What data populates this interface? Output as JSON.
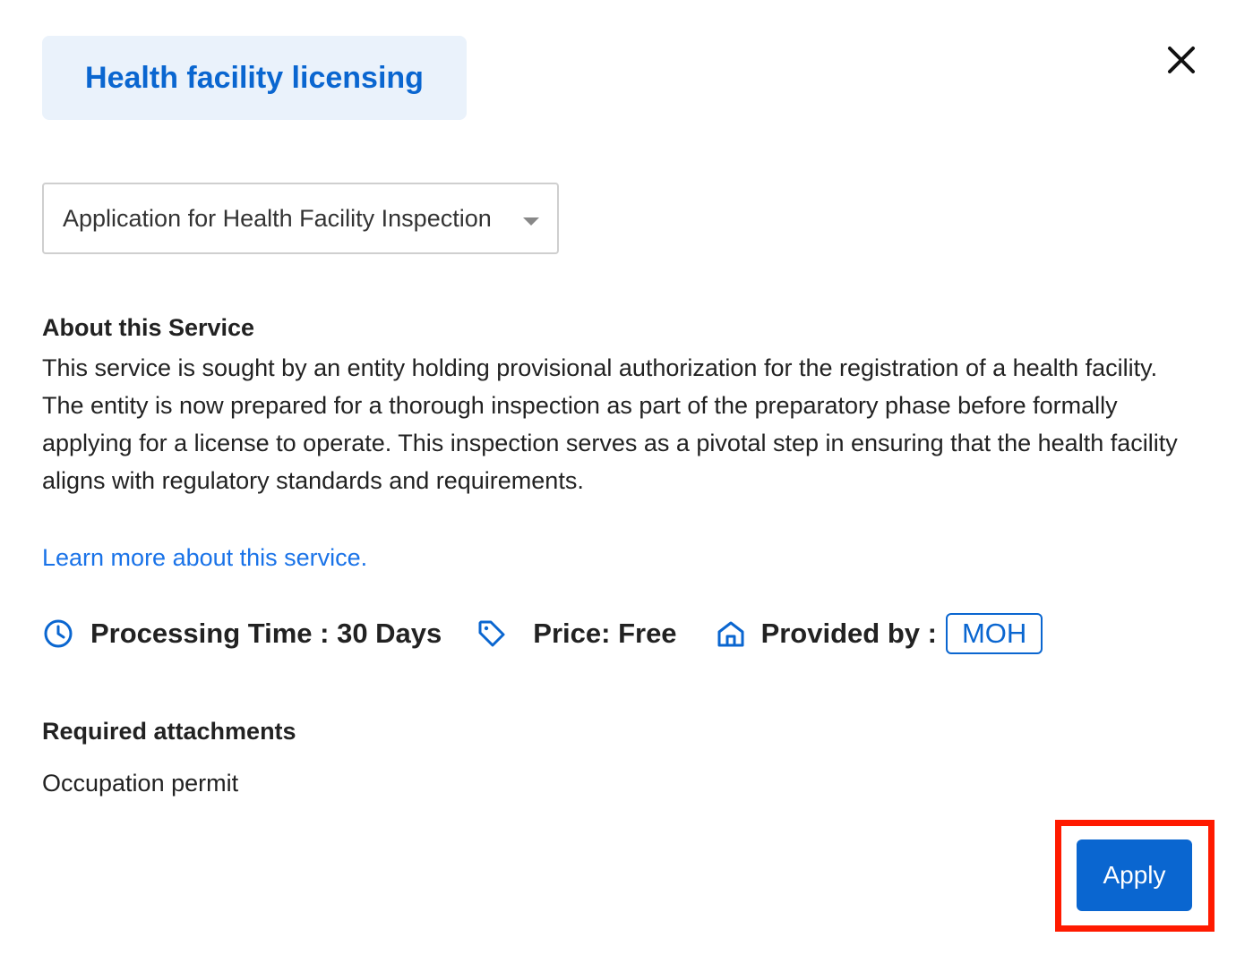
{
  "header": {
    "category_chip": "Health facility licensing",
    "close_icon": "close-icon"
  },
  "service_select": {
    "selected": "Application for Health Facility Inspection",
    "icon": "chevron-down-icon"
  },
  "about": {
    "heading": "About this Service",
    "body": "This service is sought by an entity holding provisional authorization for the registration of a health facility. The entity is now prepared for a thorough inspection as part of the preparatory phase before formally applying for a license to operate. This inspection serves as a pivotal step in ensuring that the health facility aligns with regulatory standards and requirements."
  },
  "learn_more": "Learn more about this service.",
  "meta": {
    "processing_time": "Processing Time : 30 Days",
    "price": "Price: Free",
    "provided_by_label": "Provided by :",
    "provider": "MOH",
    "icons": [
      "clock-icon",
      "tag-icon",
      "home-icon"
    ]
  },
  "attachments": {
    "heading": "Required attachments",
    "items": [
      "Occupation permit"
    ]
  },
  "actions": {
    "apply_label": "Apply"
  },
  "colors": {
    "accent": "#0a66d0",
    "link": "#1a73e8",
    "chip_bg": "#eaf2fb",
    "highlight": "#ff1a00"
  }
}
